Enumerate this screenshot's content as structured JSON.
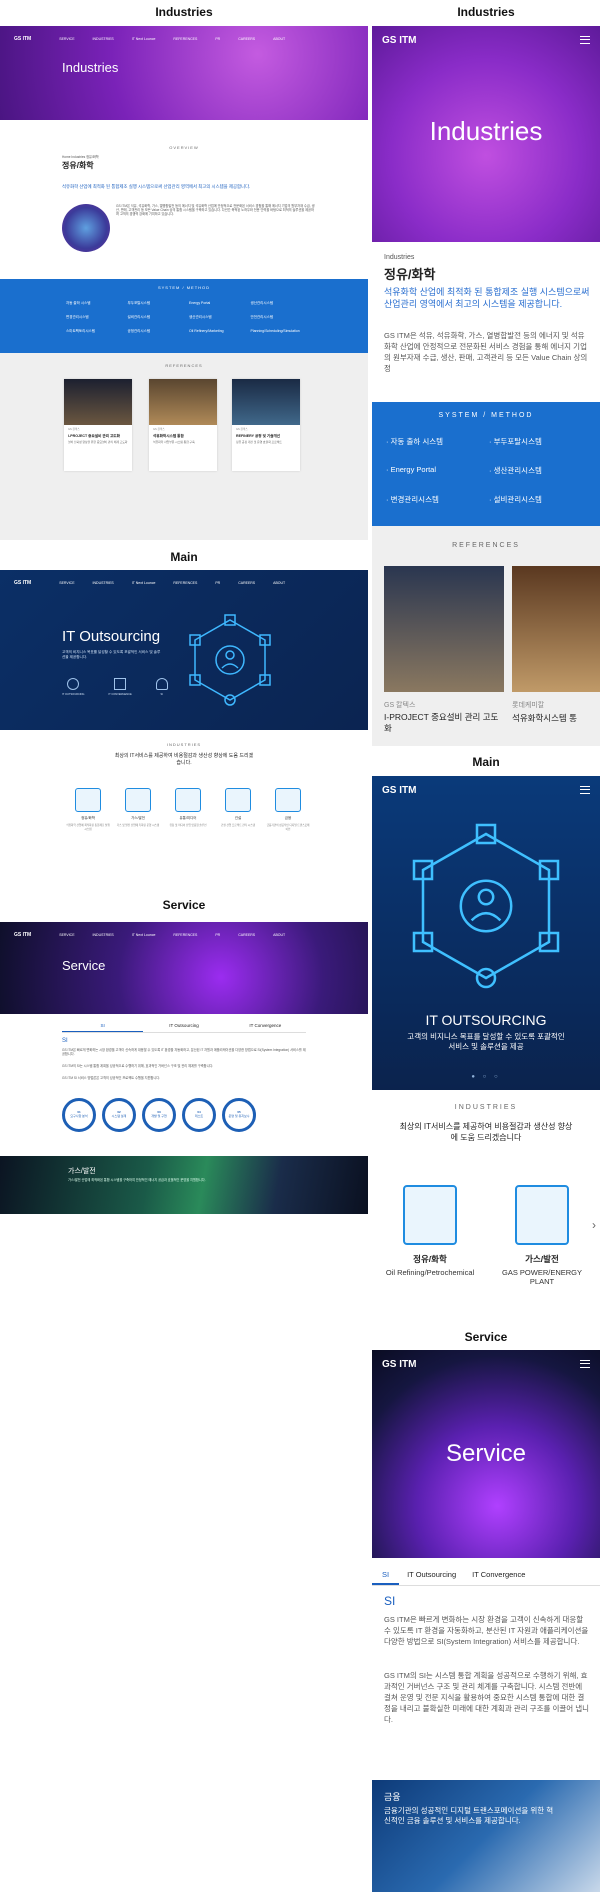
{
  "labels": {
    "industries": "Industries",
    "main": "Main",
    "service": "Service"
  },
  "nav": {
    "logo": "GS ITM",
    "items": [
      "SERVICE",
      "INDUSTRIES",
      "IT Next Lounce",
      "REFERENCES",
      "PR",
      "CAREERS",
      "ABOUT"
    ]
  },
  "desk_ind": {
    "hero": "Industries",
    "overview_tag": "OVERVIEW",
    "crumb": "Home  Industries  정유/화학",
    "title": "정유/화학",
    "lead": "석유화학 산업에 최적화 된 통합제조 실행 시스템으로써 산업관리 영역에서 최고의 시스템을 제공합니다.",
    "body": "GS ITM은 석유, 석유화학, 가스, 열병합발전 등의 에너지 및 석유화학 산업에 안정적으로 전문화된 서비스 경험을 통해 에너지 기업의 원부자재 수급, 생산, 판매, 고객관리 등 모든 Value Chain 상의 통합 시스템을 구축하고 있습니다. 다년간 축적된 노하우와 전문 인력을 바탕으로 최적의 솔루션을 제공하며 고객의 경쟁력 강화에 기여하고 있습니다.",
    "system_tag": "SYSTEM / METHOD",
    "systems": [
      "자동 출하 시스템",
      "부두포탈시스템",
      "Energy Portal",
      "생산관리시스템",
      "변경관리시스템",
      "설비관리시스템",
      "생산관리시스템",
      "안전관리시스템",
      "스마트팩토리시스템",
      "공정관리시스템",
      "Oil Refinery/Marketing",
      "Planning/Scheduling/Simulation"
    ],
    "ref_tag": "REFERENCES",
    "refs": [
      {
        "company": "GS 칼텍스",
        "title": "I-PROJECT 중요설비 관리 고도화",
        "desc": "설비 신뢰성 향상을 위한 중요설비 관리 체계 고도화"
      },
      {
        "company": "GS 칼텍스",
        "title": "석유화학시스템 통합",
        "desc": "석유화학 사업부문 시스템 통합 구축"
      },
      {
        "company": "GS 칼텍스",
        "title": "REFINERY 공정 및 기술개선",
        "desc": "정유 공정 개선 및 운영 효율화 프로젝트"
      }
    ]
  },
  "desk_main": {
    "hero": "IT Outsourcing",
    "hero_sub": "고객의 비지니스 목표를 달성할 수 있도록 포괄적인 서비스 및 솔루션을 제공합니다.",
    "icons": [
      "IT OUTSOURCING",
      "IT CONVERGENCE",
      "SI"
    ],
    "ind_tag": "INDUSTRIES",
    "ind_title": "최상의 IT서비스를 제공하여 비용절감과 생산성 향상에 도움 드리겠습니다.",
    "inds": [
      {
        "name": "정유/화학",
        "desc": "석유화학 산업에 최적화된 통합제조 실행 시스템"
      },
      {
        "name": "가스/발전",
        "desc": "가스 및 발전 산업에 특화된 운영 시스템"
      },
      {
        "name": "유통/미디어",
        "desc": "유통 및 미디어 산업 맞춤형 솔루션"
      },
      {
        "name": "건설",
        "desc": "건설 산업 프로젝트 관리 시스템"
      },
      {
        "name": "금융",
        "desc": "금융기관의 성공적인 디지털 트랜스포메이션"
      }
    ]
  },
  "desk_svc": {
    "hero": "Service",
    "tabs": [
      "SI",
      "IT Outsourcing",
      "IT Convergence"
    ],
    "si_title": "SI",
    "si_p1": "GS ITM은 빠르게 변화하는 시장 환경을 고객이 신속하게 대응할 수 있도록 IT 환경을 자동화하고, 분산된 IT 자원과 애플리케이션을 다양한 방법으로 SI(System Integration) 서비스를 제공합니다.",
    "si_p2": "GS ITM의 SI는 시스템 통합 계획을 성공적으로 수행하기 위해, 효과적인 거버넌스 구조 및 관리 체계를 구축합니다.",
    "si_p3": "GS ITM SI 서비스 방법론은 고객의 성공적인 프로젝트 수행을 지원합니다.",
    "steps": [
      {
        "n": "01",
        "t": "요구사항 분석"
      },
      {
        "n": "02",
        "t": "시스템 설계"
      },
      {
        "n": "03",
        "t": "개발 및 구현"
      },
      {
        "n": "04",
        "t": "테스트"
      },
      {
        "n": "05",
        "t": "운영 및 유지보수"
      }
    ],
    "gas_title": "가스/발전",
    "gas_desc": "가스/발전 산업에 최적화된 통합 시스템을 구축하여 안정적인 에너지 공급과 효율적인 운영을 지원합니다."
  },
  "mob_ind": {
    "hero": "Industries",
    "crumb": "Industries",
    "title": "정유/화학",
    "lead": "석유화학 산업에 최적화 된 통합제조 실행 시스템으로써 산업관리 영역에서 최고의 시스템을 제공합니다.",
    "body": "GS ITM은 석유, 석유화학, 가스, 열병합발전 등의 에너지 및 석유화학 산업에 안정적으로 전문화된 서비스 경험을 통해 에너지 기업의 원부자재 수급, 생산, 판매, 고객관리 등 모든 Value Chain 상의 정",
    "system_tag": "SYSTEM / METHOD",
    "systems": [
      "· 자동 출하 시스템",
      "· 부두포탈시스템",
      "· Energy Portal",
      "· 생산관리시스템",
      "· 변경관리시스템",
      "· 설비관리시스템"
    ],
    "ref_tag": "REFERENCES",
    "refs": [
      {
        "company": "GS 칼텍스",
        "title": "I-PROJECT 중요설비 관리 고도화"
      },
      {
        "company": "롯데케미칼",
        "title": "석유화학시스템 통"
      }
    ]
  },
  "mob_main": {
    "hero": "IT OUTSOURCING",
    "hero_sub": "고객의 비지니스 목표를 달성할 수 있도록 포괄적인서비스 및 솔루션을 제공",
    "ind_tag": "INDUSTRIES",
    "ind_title": "최상의 IT서비스를 제공하여 비용절감과 생산성 향상에 도움 드리겠습니다",
    "inds": [
      {
        "name": "정유/화학",
        "en": "Oil Refining/Petrochemical"
      },
      {
        "name": "가스/발전",
        "en": "GAS POWER/ENERGY PLANT"
      }
    ]
  },
  "mob_svc": {
    "hero": "Service",
    "tabs": [
      "SI",
      "IT Outsourcing",
      "IT Convergence"
    ],
    "si_title": "SI",
    "si_p1": "GS ITM은 빠르게 변화하는 시장 환경을 고객이 신속하게 대응할 수 있도록 IT 환경을 자동화하고, 분산된 IT 자원과 애플리케이션을 다양한 방법으로 SI(System Integration) 서비스를 제공합니다.",
    "si_p2": "GS ITM의 SI는 시스템 통합 계획을 성공적으로 수행하기 위해, 효과적인 거버넌스 구조 및 관리 체계를 구축합니다. 시스템 전반에 걸쳐 운영 및 전문 지식을 활용하여 중요한 시스템 통합에 대한 결정을 내리고 불확실한 미래에 대한 계획과 관리 구조를 이끌어 냅니다.",
    "fin_title": "금융",
    "fin_desc": "금융기관의 성공적인 디지털 트랜스포메이션을 위한 혁신적인 금융 솔루션 및 서비스를 제공합니다."
  }
}
